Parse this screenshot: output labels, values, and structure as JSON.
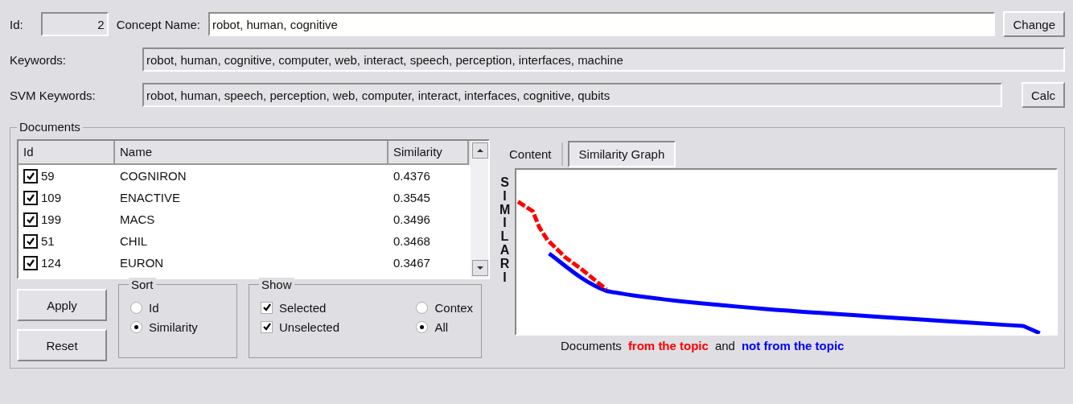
{
  "concept": {
    "id_label": "Id:",
    "id_value": "2",
    "name_label": "Concept Name:",
    "name_value": "robot, human, cognitive",
    "change_button": "Change"
  },
  "keywords": {
    "label": "Keywords:",
    "value": "robot, human, cognitive, computer, web, interact, speech, perception, interfaces, machine"
  },
  "svm_keywords": {
    "label": "SVM Keywords:",
    "value": "robot, human, speech, perception, web, computer, interact, interfaces, cognitive, qubits",
    "calc_button": "Calc"
  },
  "documents": {
    "title": "Documents",
    "columns": [
      "Id",
      "Name",
      "Similarity"
    ],
    "rows": [
      {
        "checked": true,
        "id": "59",
        "name": "COGNIRON",
        "similarity": "0.4376"
      },
      {
        "checked": true,
        "id": "109",
        "name": "ENACTIVE",
        "similarity": "0.3545"
      },
      {
        "checked": true,
        "id": "199",
        "name": "MACS",
        "similarity": "0.3496"
      },
      {
        "checked": true,
        "id": "51",
        "name": "CHIL",
        "similarity": "0.3468"
      },
      {
        "checked": true,
        "id": "124",
        "name": "EURON",
        "similarity": "0.3467"
      }
    ],
    "buttons": [
      "Apply",
      "Reset"
    ],
    "sort": {
      "title": "Sort",
      "options": [
        {
          "label": "Id",
          "selected": false
        },
        {
          "label": "Similarity",
          "selected": true
        }
      ]
    },
    "show": {
      "title": "Show",
      "checks": [
        {
          "label": "Selected",
          "checked": true
        },
        {
          "label": "Unselected",
          "checked": true
        }
      ],
      "options": [
        {
          "label": "Contex",
          "selected": false
        },
        {
          "label": "All",
          "selected": true
        }
      ]
    },
    "tabs": [
      {
        "label": "Content",
        "selected": false
      },
      {
        "label": "Similarity Graph",
        "selected": true
      }
    ],
    "graph": {
      "y_label": "SIMILARI",
      "legend": [
        {
          "text": "Documents"
        },
        {
          "text": "from the topic",
          "color": "#ff0000"
        },
        {
          "text": "and"
        },
        {
          "text": "not from the topic",
          "color": "#0000ff"
        }
      ]
    }
  }
}
